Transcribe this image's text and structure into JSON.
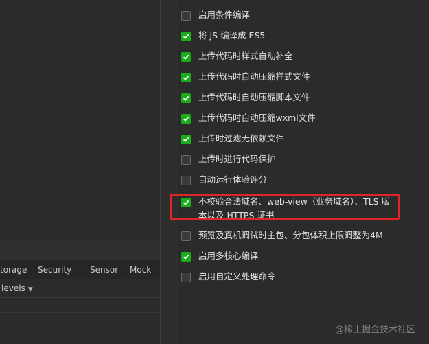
{
  "colors": {
    "checked": "#1aad19",
    "highlight": "#e0242a",
    "background": "#2b2b2b"
  },
  "devtools": {
    "tabs": [
      "torage",
      "Security",
      "Sensor",
      "Mock"
    ],
    "levels_label": "levels",
    "levels_icon": "caret-down-icon"
  },
  "options": [
    {
      "label": "启用条件编译",
      "checked": false
    },
    {
      "label": "将 JS 编译成 ES5",
      "checked": true
    },
    {
      "label": "上传代码时样式自动补全",
      "checked": true
    },
    {
      "label": "上传代码时自动压缩样式文件",
      "checked": true
    },
    {
      "label": "上传代码时自动压缩脚本文件",
      "checked": true
    },
    {
      "label": "上传代码时自动压缩wxml文件",
      "checked": true
    },
    {
      "label": "上传时过滤无依赖文件",
      "checked": true
    },
    {
      "label": "上传时进行代码保护",
      "checked": false
    },
    {
      "label": "自动运行体验评分",
      "checked": false
    },
    {
      "label": "不校验合法域名、web-view（业务域名）、TLS 版本以及 HTTPS 证书",
      "checked": true
    },
    {
      "label": "预览及真机调试时主包、分包体积上限调整为4M",
      "checked": false
    },
    {
      "label": "启用多核心编译",
      "checked": true
    },
    {
      "label": "启用自定义处理命令",
      "checked": false
    }
  ],
  "watermark": "@稀土掘金技术社区"
}
